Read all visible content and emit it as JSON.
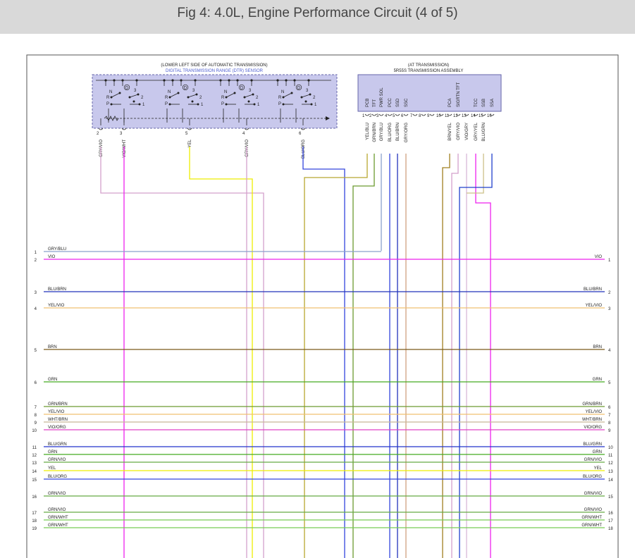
{
  "title": "Fig 4: 4.0L, Engine Performance Circuit (4 of 5)",
  "dtr_sensor": {
    "location": "(LOWER LEFT SIDE OF AUTOMATIC TRANSMISSION)",
    "name": "DIGITAL TRANSMISSION RANGE (DTR) SENSOR",
    "switch_letters": [
      "N",
      "R",
      "P"
    ],
    "switch_numbers": [
      "3",
      "2",
      "1"
    ],
    "drive_symbol": "D",
    "pins": [
      {
        "pin": "2",
        "wire": "GRY/VIO"
      },
      {
        "pin": "3",
        "wire": "VIO/WHT"
      },
      {
        "pin": "5",
        "wire": "YEL"
      },
      {
        "pin": "4",
        "wire": "GRY/VIO"
      },
      {
        "pin": "6",
        "wire": "BLU/ORG"
      }
    ]
  },
  "trans_assembly": {
    "location": "(AT TRANSMISSION)",
    "name": "5R55S TRANSMISSION ASSEMBLY",
    "terminals": [
      {
        "pin": "1",
        "label": "PCB",
        "wire": "YEL/BLU"
      },
      {
        "pin": "2",
        "label": "TFT",
        "wire": "GRN/BRN"
      },
      {
        "pin": "3",
        "label": "PWR SOL",
        "wire": "GRY/BLU"
      },
      {
        "pin": "4",
        "label": "PCC",
        "wire": "BLU/ORG"
      },
      {
        "pin": "5",
        "label": "SSD",
        "wire": "BLU/BRN"
      },
      {
        "pin": "6",
        "label": "SSC",
        "wire": "GRY/ORG"
      },
      {
        "pin": "7",
        "label": "",
        "wire": ""
      },
      {
        "pin": "8",
        "label": "",
        "wire": ""
      },
      {
        "pin": "9",
        "label": "",
        "wire": ""
      },
      {
        "pin": "10",
        "label": "",
        "wire": ""
      },
      {
        "pin": "11",
        "label": "PCA",
        "wire": "BRN/YEL"
      },
      {
        "pin": "12",
        "label": "SIGRTN TFT",
        "wire": "GRY/VIO"
      },
      {
        "pin": "13",
        "label": "",
        "wire": "VIO/GRY"
      },
      {
        "pin": "14",
        "label": "TCC",
        "wire": "GRY/YEL"
      },
      {
        "pin": "15",
        "label": "SSB",
        "wire": "BLU/GRN"
      },
      {
        "pin": "16",
        "label": "SSA",
        "wire": ""
      }
    ]
  },
  "left_lines": [
    {
      "n": "1",
      "label": "GRY/BLU"
    },
    {
      "n": "2",
      "label": "VIO"
    },
    {
      "n": "3",
      "label": "BLU/BRN"
    },
    {
      "n": "4",
      "label": "YEL/VIO"
    },
    {
      "n": "5",
      "label": "BRN"
    },
    {
      "n": "6",
      "label": "GRN"
    },
    {
      "n": "7",
      "label": "GRN/BRN"
    },
    {
      "n": "8",
      "label": "YEL/VIO"
    },
    {
      "n": "9",
      "label": "WHT/BRN"
    },
    {
      "n": "10",
      "label": "VIO/ORG"
    },
    {
      "n": "11",
      "label": "BLU/GRN"
    },
    {
      "n": "12",
      "label": "GRN"
    },
    {
      "n": "13",
      "label": "GRN/VIO"
    },
    {
      "n": "14",
      "label": "YEL"
    },
    {
      "n": "15",
      "label": "BLU/ORG"
    },
    {
      "n": "16",
      "label": "GRN/VIO"
    },
    {
      "n": "17",
      "label": "GRN/VIO"
    },
    {
      "n": "18",
      "label": "GRN/WHT"
    },
    {
      "n": "19",
      "label": "GRN/WHT"
    }
  ],
  "right_lines": [
    {
      "n": "1",
      "label": "VIO"
    },
    {
      "n": "2",
      "label": "BLU/BRN"
    },
    {
      "n": "3",
      "label": "YEL/VIO"
    },
    {
      "n": "4",
      "label": "BRN"
    },
    {
      "n": "5",
      "label": "GRN"
    },
    {
      "n": "6",
      "label": "GRN/BRN"
    },
    {
      "n": "7",
      "label": "YEL/VIO"
    },
    {
      "n": "8",
      "label": "WHT/BRN"
    },
    {
      "n": "9",
      "label": "VIO/ORG"
    },
    {
      "n": "10",
      "label": "BLU/GRN"
    },
    {
      "n": "11",
      "label": "GRN"
    },
    {
      "n": "12",
      "label": "GRN/VIO"
    },
    {
      "n": "13",
      "label": "YEL"
    },
    {
      "n": "14",
      "label": "BLU/ORG"
    },
    {
      "n": "15",
      "label": "GRN/VIO"
    },
    {
      "n": "16",
      "label": "GRN/VIO"
    },
    {
      "n": "17",
      "label": "GRN/WHT"
    },
    {
      "n": "18",
      "label": "GRN/WHT"
    }
  ],
  "colors": {
    "VIO": "#ee22ee",
    "GRY/BLU": "#8aa0cc",
    "BLU/BRN": "#2233bb",
    "YEL/VIO": "#f0c070",
    "BRN": "#7a5a1a",
    "GRN": "#44aa22",
    "GRN/BRN": "#6c9a30",
    "WHT/BRN": "#c8b898",
    "VIO/ORG": "#e040c8",
    "BLU/GRN": "#2233cc",
    "GRN/VIO": "#66aa44",
    "YEL": "#eeee00",
    "BLU/ORG": "#3344dd",
    "GRN/WHT": "#77cc55",
    "GRY/VIO": "#d4a0cc",
    "VIO/WHT": "#ee22ee",
    "YEL/BLU": "#b8a830",
    "GRY/ORG": "#d0a080",
    "BRN/YEL": "#a08020",
    "VIO/GRY": "#d8b8d8",
    "GRY/YEL": "#ccc088",
    "BLU/GRN_V": "#2040cc",
    "sensor_fill": "#c8c8ec",
    "sensor_border": "#6666aa",
    "title_blue": "#4a5bd0"
  }
}
